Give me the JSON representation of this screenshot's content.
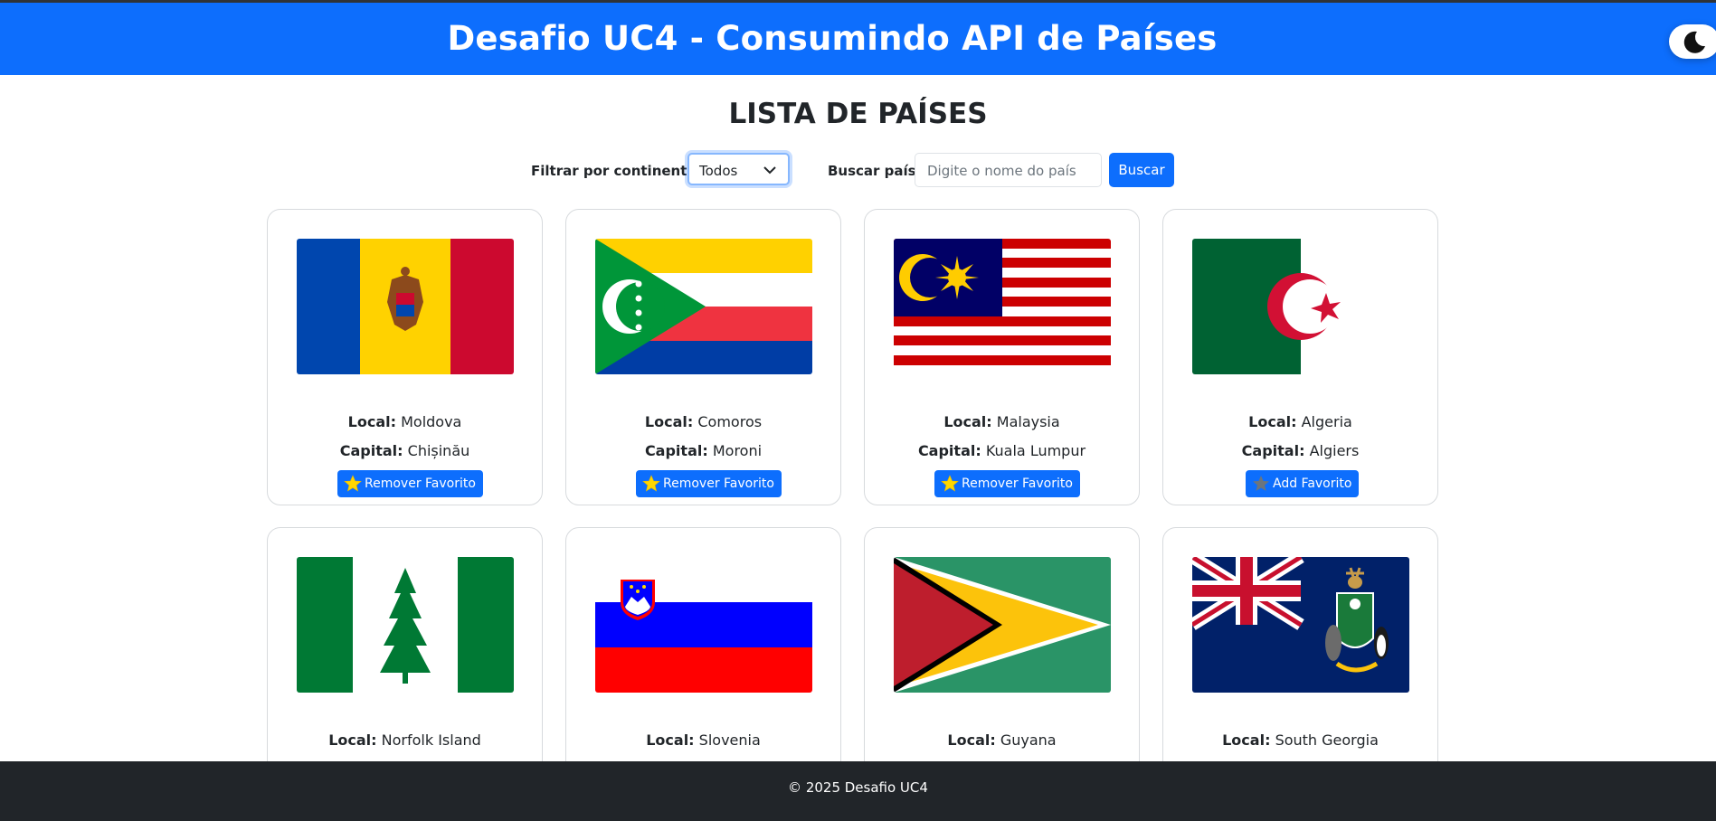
{
  "header": {
    "title": "Desafio UC4 - Consumindo API de Países",
    "theme_icon": "moon-icon"
  },
  "page_title": "LISTA DE PAÍSES",
  "filters": {
    "continent_label": "Filtrar por continente:",
    "continent_value": "Todos",
    "search_label": "Buscar país:",
    "search_placeholder": "Digite o nome do país",
    "search_button": "Buscar"
  },
  "labels": {
    "local": "Local:",
    "capital": "Capital:"
  },
  "countries": [
    {
      "name": "Moldova",
      "capital": "Chișinău",
      "favorite": true,
      "button": "Remover Favorito"
    },
    {
      "name": "Comoros",
      "capital": "Moroni",
      "favorite": true,
      "button": "Remover Favorito"
    },
    {
      "name": "Malaysia",
      "capital": "Kuala Lumpur",
      "favorite": true,
      "button": "Remover Favorito"
    },
    {
      "name": "Algeria",
      "capital": "Algiers",
      "favorite": false,
      "button": "Add Favorito"
    },
    {
      "name": "Norfolk Island"
    },
    {
      "name": "Slovenia"
    },
    {
      "name": "Guyana"
    },
    {
      "name": "South Georgia"
    }
  ],
  "footer": {
    "text": "© 2025 Desafio UC4"
  },
  "colors": {
    "primary": "#0d6efd",
    "dark": "#212529",
    "star_active": "#ffd700",
    "star_inactive": "#6c757d"
  }
}
